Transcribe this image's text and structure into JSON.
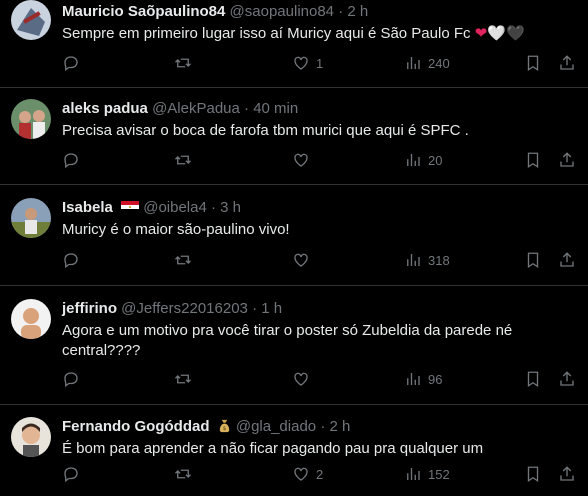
{
  "replies": [
    {
      "name": "Mauricio Saõpaulino84",
      "handle": "@saopaulino84",
      "dot": "·",
      "time": "2 h",
      "text": "Sempre em primeiro lugar isso aí Muricy aqui é São Paulo Fc",
      "hearts": [
        "❤",
        "🤍",
        "🖤"
      ],
      "likes": "1",
      "views": "240"
    },
    {
      "name": "aleks padua",
      "handle": "@AlekPadua",
      "dot": "·",
      "time": "40 min",
      "text": "Precisa avisar o boca de farofa tbm murici que aqui é SPFC .",
      "likes": "",
      "views": "20"
    },
    {
      "name": "Isabela",
      "handle": "@oibela4",
      "dot": "·",
      "time": "3 h",
      "text": "Muricy é o maior são-paulino vivo!",
      "likes": "",
      "views": "318"
    },
    {
      "name": "jeffirino",
      "handle": "@Jeffers22016203",
      "dot": "·",
      "time": "1 h",
      "text": "Agora e um motivo pra você tirar o poster só Zubeldia da parede né central????",
      "likes": "",
      "views": "96"
    },
    {
      "name": "Fernando Gogóddad",
      "handle": "@gla_diado",
      "dot": "·",
      "time": "2 h",
      "text": "É bom para aprender a não ficar pagando pau pra qualquer um",
      "likes": "2",
      "views": "152"
    }
  ],
  "colors": {
    "background": "#000000",
    "text": "#e7e9ea",
    "muted": "#71767b",
    "divider": "#2f3336"
  },
  "icons": [
    "reply-icon",
    "retweet-icon",
    "like-icon",
    "views-icon",
    "bookmark-icon",
    "share-icon"
  ]
}
